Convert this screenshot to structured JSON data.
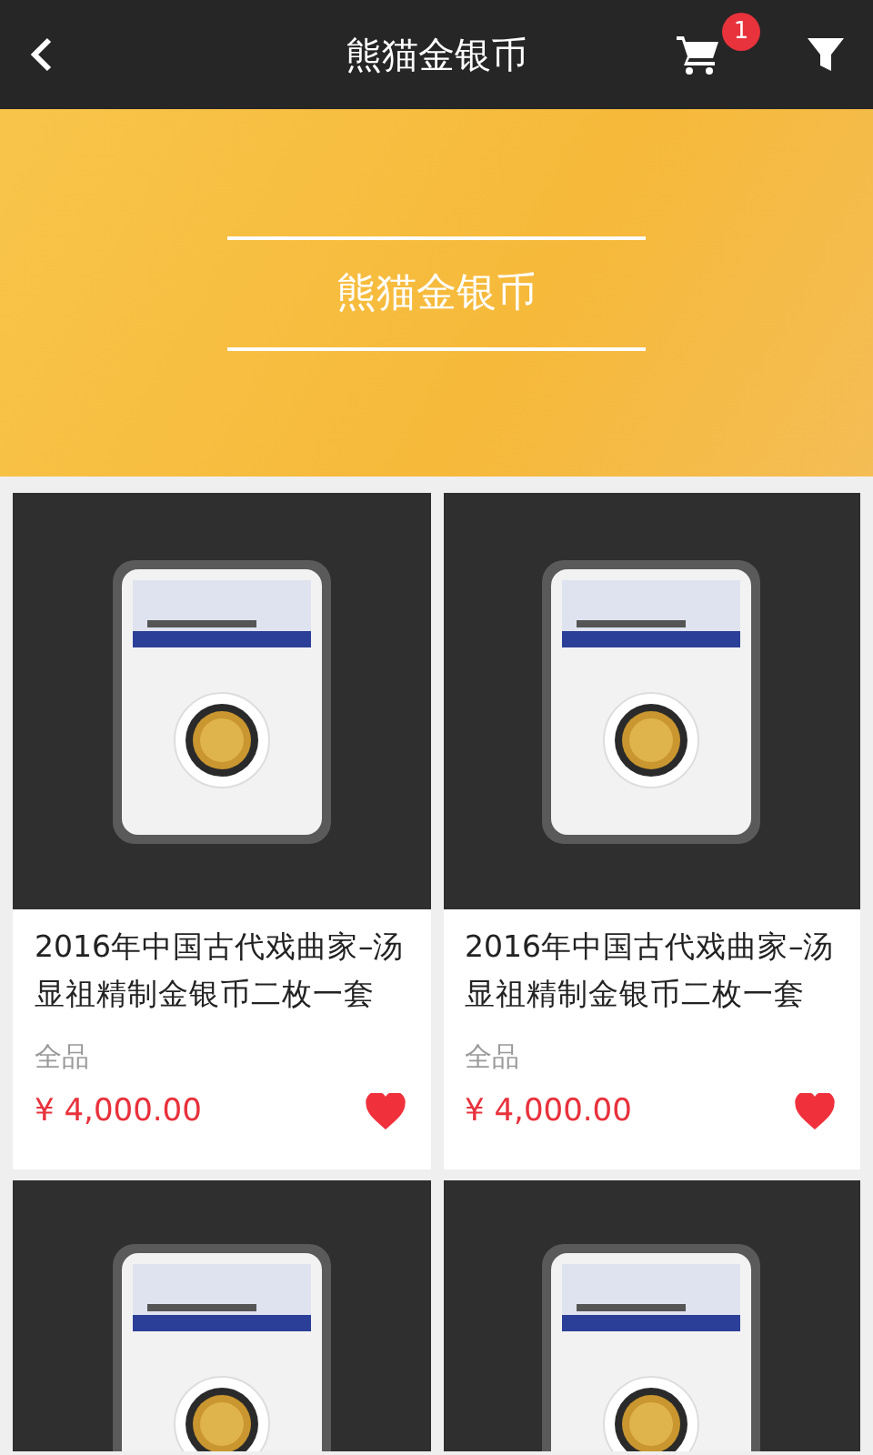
{
  "header": {
    "title": "熊猫金银币",
    "cart_badge": "1"
  },
  "banner": {
    "title": "熊猫金银币"
  },
  "products": [
    {
      "kind": "full",
      "title": "2016年中国古代戏曲家–汤显祖精制金银币二枚一套",
      "condition": "全品",
      "price": "¥ 4,000.00",
      "favorite": true
    },
    {
      "kind": "full",
      "title": "2016年中国古代戏曲家–汤显祖精制金银币二枚一套",
      "condition": "全品",
      "price": "¥ 4,000.00",
      "favorite": true
    },
    {
      "kind": "image"
    },
    {
      "kind": "image"
    }
  ]
}
